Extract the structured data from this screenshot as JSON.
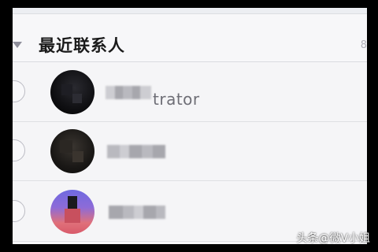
{
  "section": {
    "title": "最近联系人",
    "count": "8"
  },
  "contacts": [
    {
      "name_visible": "trator",
      "avatar": "dark-avatar"
    },
    {
      "name_visible": "",
      "avatar": "dark-avatar"
    },
    {
      "name_visible": "",
      "avatar": "purple-avatar"
    }
  ],
  "watermark": "头条@微V小姐",
  "colors": {
    "background": "#f6f6f8",
    "frame": "#000000",
    "divider": "#dedfe3",
    "title_text": "#1a1a1a"
  }
}
